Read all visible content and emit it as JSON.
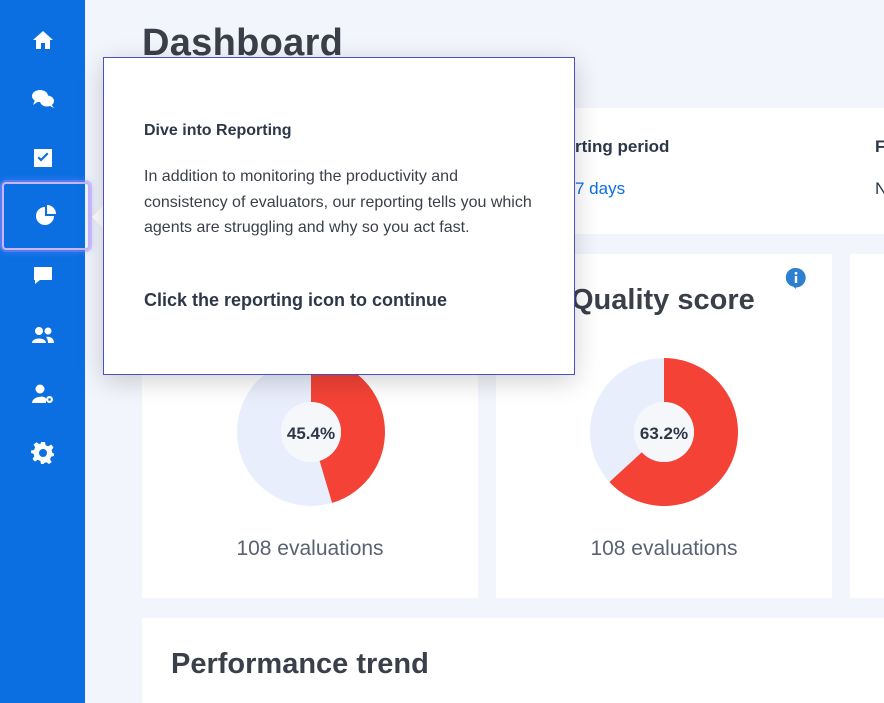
{
  "sidebar": {
    "items": [
      {
        "icon": "home-icon"
      },
      {
        "icon": "conversations-icon"
      },
      {
        "icon": "checkbox-icon"
      },
      {
        "icon": "reporting-pie-icon",
        "active": true
      },
      {
        "icon": "feedback-icon"
      },
      {
        "icon": "users-icon"
      },
      {
        "icon": "user-settings-icon"
      },
      {
        "icon": "gear-icon"
      }
    ]
  },
  "page": {
    "title": "Dashboard"
  },
  "filters": {
    "period_label": "rting period",
    "period_value": "7 days",
    "third_label": "F",
    "third_value": "N"
  },
  "cards": [
    {
      "title": "",
      "value_label": "45.4%",
      "value": 45.4,
      "footer": "108 evaluations"
    },
    {
      "title": "Quality score",
      "value_label": "63.2%",
      "value": 63.2,
      "footer": "108 evaluations"
    }
  ],
  "trend": {
    "title": "Performance trend"
  },
  "popover": {
    "title": "Dive into Reporting",
    "body": "In addition to monitoring the productivity and consistency of evaluators, our reporting tells you which agents are struggling and why so you act fast.",
    "cta": "Click the reporting icon to continue"
  },
  "colors": {
    "sidebar": "#0b6fe2",
    "donut_fill": "#f44336",
    "donut_track": "#e8eefb",
    "link": "#0b6fe2",
    "popover_border": "#4b4fc4",
    "info": "#2d7fcf"
  }
}
